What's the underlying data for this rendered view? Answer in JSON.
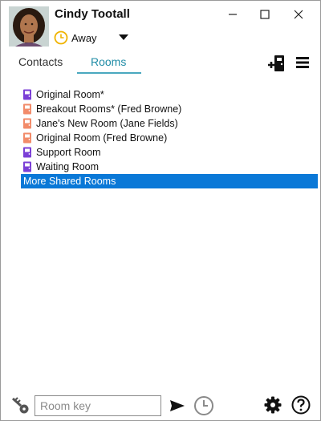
{
  "user": {
    "name": "Cindy  Tootall",
    "status": "Away",
    "avatar_icon": "user-avatar"
  },
  "window_controls": [
    "minimize-icon",
    "maximize-icon",
    "close-icon"
  ],
  "tabs": [
    {
      "label": "Contacts",
      "active": false
    },
    {
      "label": "Rooms",
      "active": true
    }
  ],
  "toolbar": {
    "add_room_icon": "add-room-icon",
    "menu_icon": "hamburger-menu-icon"
  },
  "rooms": [
    {
      "label": "Original Room*",
      "icon_color": "#7b3fd6"
    },
    {
      "label": "Breakout Rooms* (Fred Browne)",
      "icon_color": "#f28b6a"
    },
    {
      "label": "Jane's New Room (Jane Fields)",
      "icon_color": "#f28b6a"
    },
    {
      "label": "Original Room (Fred Browne)",
      "icon_color": "#f28b6a"
    },
    {
      "label": "Support Room",
      "icon_color": "#7b3fd6"
    },
    {
      "label": "Waiting Room",
      "icon_color": "#7b3fd6"
    }
  ],
  "more_shared_rooms": {
    "label": "More Shared Rooms",
    "selected": true,
    "highlight_color": "#0a78d7"
  },
  "bottom_bar": {
    "room_key_placeholder": "Room key",
    "icons": [
      "key-icon",
      "send-icon",
      "history-clock-icon",
      "settings-gear-icon",
      "help-icon"
    ]
  },
  "colors": {
    "accent": "#1f8ca6",
    "status_away": "#f0b400"
  }
}
